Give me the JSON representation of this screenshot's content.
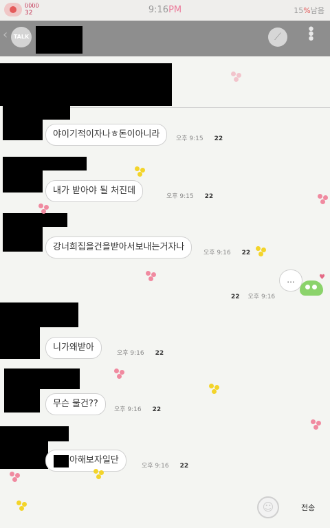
{
  "status": {
    "brand_line1": "ὓὓὓὓ",
    "brand_line2": "32",
    "time_prefix": "9:16",
    "time_suffix": "PM",
    "battery_pct": "15",
    "battery_unit": "%",
    "battery_label": "남음"
  },
  "header": {
    "talk_badge": "TALK"
  },
  "messages": [
    {
      "text": "야이기적이자나ㅎ돈이아니라",
      "meta": "오후 9:15",
      "count": "22"
    },
    {
      "text": "내가 받아야 될 처진데",
      "meta": "오후 9:15",
      "count": "22"
    },
    {
      "text": "강너희집을건을받아서보내는거자나",
      "meta": "오후 9:16",
      "count": "22"
    },
    {
      "text": "니가왜받아",
      "meta": "오후 9:16",
      "count": "22"
    },
    {
      "text": "무슨 물건??",
      "meta": "오후 9:16",
      "count": "22"
    },
    {
      "text": "아해보자일단",
      "meta": "오후 9:16",
      "count": "22"
    }
  ],
  "sent": {
    "meta": "오후 9:16",
    "count": "22",
    "bubble": "..."
  },
  "input": {
    "send_label": "전송"
  },
  "colors": {
    "header_bg": "#8e8e8e",
    "chat_bg": "#f4f5f2",
    "accent_pink": "#e45b5b",
    "flower_pink": "#f08aa0",
    "flower_yellow": "#f3d42a",
    "sticker_green": "#8bd36b"
  },
  "icons": {
    "back": "chevron-left-icon",
    "talk": "talk-badge-icon",
    "tool": "tool-icon",
    "menu": "more-vertical-icon",
    "emoji": "emoji-icon"
  }
}
